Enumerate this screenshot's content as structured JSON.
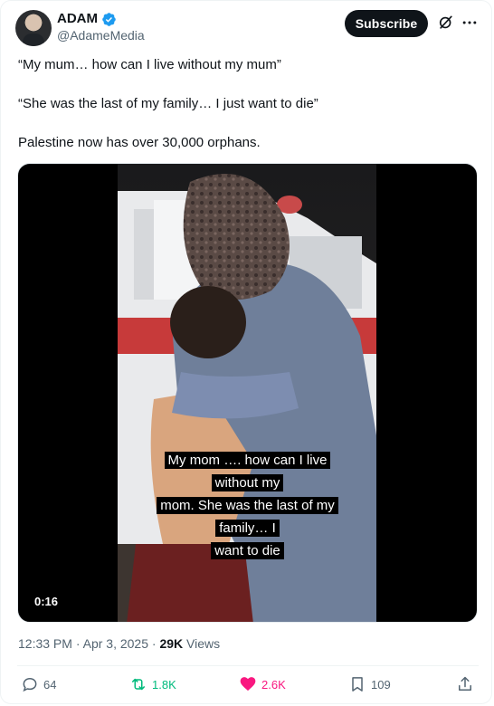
{
  "author": {
    "name": "ADAM",
    "handle": "@AdameMedia",
    "verified_color": "#1d9bf0"
  },
  "header": {
    "subscribe_label": "Subscribe",
    "icons": [
      "grok-icon",
      "more-icon"
    ]
  },
  "post": {
    "lines": [
      "“My mum… how can I live without my mum”",
      "“She was the last of my family… I just want to die”",
      "Palestine now has over 30,000 orphans."
    ]
  },
  "video": {
    "caption_lines": [
      "My mom …. how can I live without my",
      "mom. She was the last of my family… I",
      "want to die"
    ],
    "duration": "0:16"
  },
  "meta": {
    "time": "12:33 PM",
    "date": "Apr 3, 2025",
    "views_count": "29K",
    "views_label": "Views"
  },
  "actions": {
    "replies": "64",
    "reposts": "1.8K",
    "likes": "2.6K",
    "bookmarks": "109",
    "repost_color": "#00ba7c",
    "like_color": "#f91880"
  }
}
